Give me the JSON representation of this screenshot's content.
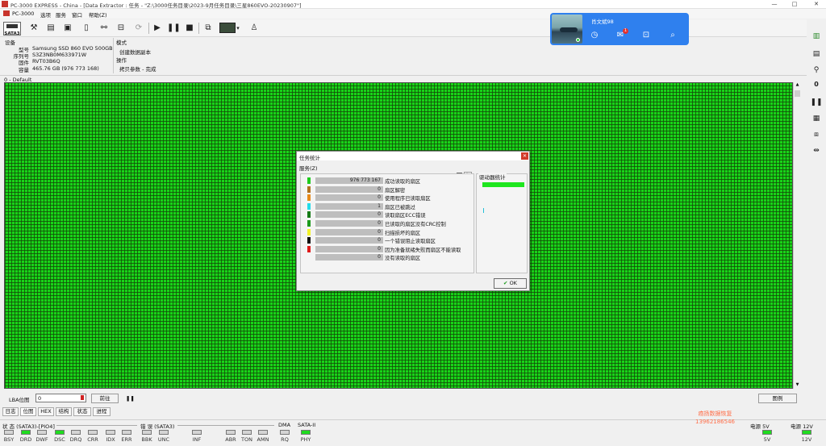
{
  "window": {
    "title": "PC-3000 EXPRESS - China - [Data Extractor : 任务 - \"Z:\\3000任务目录\\2023-9月任务目录\\三星860EVO-20230907\"]",
    "minimize": "—",
    "maximize": "□",
    "close": "✕"
  },
  "menu": {
    "items": [
      "PC-3000",
      "选项",
      "服务",
      "窗口",
      "帮助(Z)"
    ]
  },
  "toolbar": {
    "sata_label": "SATA3"
  },
  "device": {
    "section_label": "设备",
    "model_label": "型号",
    "model": "Samsung SSD 860 EVO 500GB",
    "serial_label": "序列号",
    "serial": "S3Z3NB0M633971W",
    "firmware_label": "固件",
    "firmware": "RVT03B6Q",
    "capacity_label": "容量",
    "capacity": "465.76 GB (976 773 168)"
  },
  "mode": {
    "section_label": "模式",
    "value": "创建数据副本",
    "operation_label": "操作",
    "operation": "拷贝参数 - 完成"
  },
  "map": {
    "tab_label": "0 - Default"
  },
  "bottom": {
    "lba_label": "LBA位图",
    "lba_value": "0",
    "goto_label": "前往",
    "pause_icon": "❚❚",
    "legend_button": "图例",
    "tabs": [
      "日志",
      "位图",
      "HEX",
      "结构",
      "状态",
      "进程"
    ]
  },
  "status": {
    "group1_label": "状 态 (SATA3)-[PIO4]",
    "group1": [
      {
        "label": "BSY",
        "on": false
      },
      {
        "label": "DRD",
        "on": true
      },
      {
        "label": "DWF",
        "on": false
      },
      {
        "label": "DSC",
        "on": true
      },
      {
        "label": "DRQ",
        "on": false
      },
      {
        "label": "CRR",
        "on": false
      },
      {
        "label": "IDX",
        "on": false
      },
      {
        "label": "ERR",
        "on": false
      }
    ],
    "group2_label": "错 误 (SATA3)",
    "group2": [
      {
        "label": "BBK",
        "on": false
      },
      {
        "label": "UNC",
        "on": false
      },
      {
        "label": "INF",
        "on": false
      },
      {
        "label": "ABR",
        "on": false
      },
      {
        "label": "TON",
        "on": false
      },
      {
        "label": "AMN",
        "on": false
      }
    ],
    "dma_label": "DMA",
    "dma": {
      "label": "RQ",
      "on": false
    },
    "sata2_label": "SATA-II",
    "sata2": {
      "label": "PHY",
      "on": true
    },
    "power5_label": "电源 5V",
    "power5": "5V",
    "power12_label": "电源 12V",
    "power12": "12V"
  },
  "watermark": {
    "line1": "癌扬数据恢复",
    "line2": "13962186546"
  },
  "dialog": {
    "title": "任务统计",
    "subtitle": "服务(Z)",
    "increment_label": "增量",
    "drive_stats_label": "驱动器统计",
    "ok_label": "OK",
    "rows": [
      {
        "color": "#1ecb1e",
        "value": "976 773 167",
        "desc": "成功读取的扇区"
      },
      {
        "color": "#b07020",
        "value": "0",
        "desc": "扇区解密"
      },
      {
        "color": "#e88a1a",
        "value": "0",
        "desc": "使用程序已读取扇区"
      },
      {
        "color": "#22dcea",
        "value": "1",
        "desc": "扇区已被跳过"
      },
      {
        "color": "#157a15",
        "value": "0",
        "desc": "读取扇区ECC错误"
      },
      {
        "color": "#1b9a1b",
        "value": "0",
        "desc": "已读取的扇区没有CRC控制"
      },
      {
        "color": "#f2f22a",
        "value": "0",
        "desc": "扫描损坏的扇区"
      },
      {
        "color": "#111111",
        "value": "0",
        "desc": "一个错误阻止读取扇区"
      },
      {
        "color": "#e01a1a",
        "value": "0",
        "desc": "因为准备就绪失败而扇区不能读取"
      },
      {
        "color": "#f4f4f4",
        "value": "0",
        "desc": "没有读取的扇区"
      }
    ]
  },
  "popup": {
    "name": "肖文斌98",
    "badge": "1"
  },
  "colors": {
    "map_green": "#18d418",
    "popup_blue": "#2f80ee",
    "title_red": "#c8342c"
  }
}
